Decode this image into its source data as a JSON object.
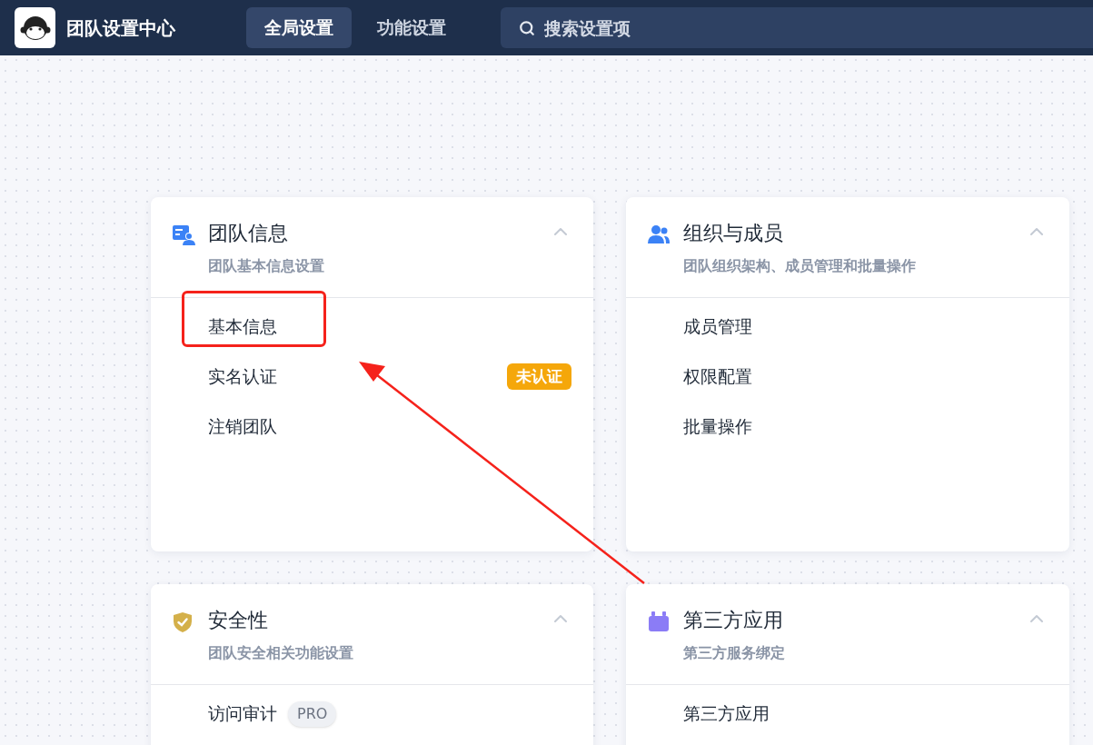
{
  "header": {
    "title": "团队设置中心",
    "tabs": [
      {
        "label": "全局设置",
        "selected": true
      },
      {
        "label": "功能设置",
        "selected": false
      }
    ],
    "search": {
      "placeholder": "搜索设置项"
    }
  },
  "cards": [
    {
      "title": "团队信息",
      "subtitle": "团队基本信息设置",
      "expanded": true,
      "items": [
        {
          "label": "基本信息"
        },
        {
          "label": "实名认证",
          "badge": {
            "text": "未认证",
            "kind": "warning"
          }
        },
        {
          "label": "注销团队"
        }
      ]
    },
    {
      "title": "组织与成员",
      "subtitle": "团队组织架构、成员管理和批量操作",
      "expanded": true,
      "items": [
        {
          "label": "成员管理"
        },
        {
          "label": "权限配置"
        },
        {
          "label": "批量操作"
        }
      ]
    },
    {
      "title": "安全性",
      "subtitle": "团队安全相关功能设置",
      "expanded": true,
      "items": [
        {
          "label": "访问审计",
          "badge": {
            "text": "PRO",
            "kind": "pro"
          }
        }
      ]
    },
    {
      "title": "第三方应用",
      "subtitle": "第三方服务绑定",
      "expanded": true,
      "items": [
        {
          "label": "第三方应用"
        }
      ]
    }
  ]
}
